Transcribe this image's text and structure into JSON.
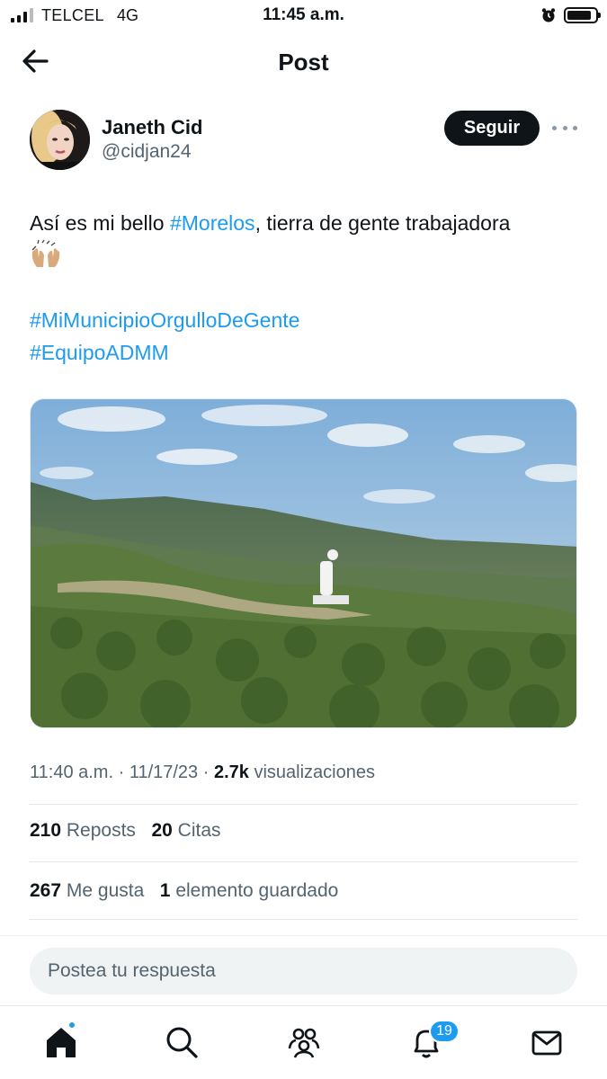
{
  "status_bar": {
    "carrier": "TELCEL",
    "network": "4G",
    "time": "11:45 a.m."
  },
  "header": {
    "title": "Post",
    "back_icon": "arrow-left-icon"
  },
  "author": {
    "name": "Janeth Cid",
    "handle": "@cidjan24",
    "follow_label": "Seguir",
    "more_icon": "more-horizontal-icon"
  },
  "tweet": {
    "text_before": "Así es mi bello ",
    "hashtag_1": "#Morelos",
    "text_after": ", tierra de gente trabajadora",
    "emoji": "🙌🏼",
    "hashtag_2": "#MiMunicipioOrgulloDeGente",
    "hashtag_3": "#EquipoADMM",
    "link_color": "#1d9bf0"
  },
  "media": {
    "kind": "video-thumbnail"
  },
  "meta": {
    "time": "11:40 a.m.",
    "separator": " · ",
    "date": "11/17/23",
    "views_count": "2.7k",
    "views_label": "visualizaciones"
  },
  "stats": {
    "reposts_count": "210",
    "reposts_label": "Reposts",
    "quotes_count": "20",
    "quotes_label": "Citas",
    "likes_count": "267",
    "likes_label": "Me gusta",
    "bookmarks_count": "1",
    "bookmarks_label": "elemento guardado"
  },
  "reply": {
    "placeholder": "Postea tu respuesta"
  },
  "tab_bar": {
    "items": [
      {
        "icon": "home-icon"
      },
      {
        "icon": "search-icon"
      },
      {
        "icon": "communities-icon"
      },
      {
        "icon": "notifications-icon"
      },
      {
        "icon": "messages-icon"
      }
    ],
    "notifications_badge": "19"
  }
}
